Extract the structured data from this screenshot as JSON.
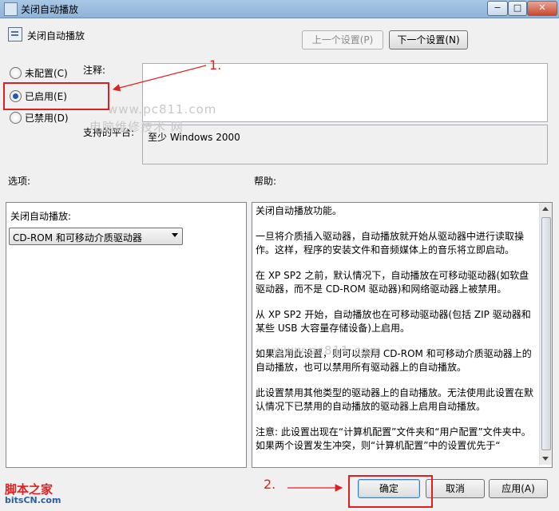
{
  "window": {
    "title": "关闭自动播放",
    "controls": {
      "minimize": "−",
      "maximize": "□",
      "close": "✕"
    }
  },
  "header": {
    "title": "关闭自动播放",
    "prev_button": "上一个设置(P)",
    "next_button": "下一个设置(N)"
  },
  "state": {
    "options": [
      {
        "label": "未配置(C)",
        "selected": false
      },
      {
        "label": "已启用(E)",
        "selected": true
      },
      {
        "label": "已禁用(D)",
        "selected": false
      }
    ]
  },
  "comment": {
    "label": "注释:",
    "value": ""
  },
  "supported": {
    "label": "支持的平台:",
    "value": "至少 Windows 2000"
  },
  "options_panel": {
    "heading": "选项:",
    "field_label": "关闭自动播放:",
    "selected_value": "CD-ROM 和可移动介质驱动器"
  },
  "help_panel": {
    "heading": "帮助:",
    "paragraphs": [
      "关闭自动播放功能。",
      "一旦将介质插入驱动器，自动播放就开始从驱动器中进行读取操作。这样，程序的安装文件和音频媒体上的音乐将立即启动。",
      "在 XP SP2 之前，默认情况下，自动播放在可移动驱动器(如软盘驱动器，而不是 CD-ROM 驱动器)和网络驱动器上被禁用。",
      "从 XP SP2 开始，自动播放也在可移动驱动器(包括 ZIP 驱动器和某些 USB 大容量存储设备)上启用。",
      "如果启用此设置，则可以禁用 CD-ROM 和可移动介质驱动器上的自动播放，也可以禁用所有驱动器上的自动播放。",
      "此设置禁用其他类型的驱动器上的自动播放。无法使用此设置在默认情况下已禁用的自动播放的驱动器上启用自动播放。",
      "注意: 此设置出现在“计算机配置”文件夹和“用户配置”文件夹中。如果两个设置发生冲突，则“计算机配置”中的设置优先于“"
    ]
  },
  "footer": {
    "ok": "确定",
    "cancel": "取消",
    "apply": "应用(A)"
  },
  "annotations": {
    "step1": "1.",
    "step2": "2.",
    "accent_color": "#e02020"
  },
  "watermarks": {
    "url": "www.pc811.com",
    "site": "电脑维修技术 网",
    "logo_top": "脚本之家",
    "logo_bottom": "bitsCN.com"
  }
}
